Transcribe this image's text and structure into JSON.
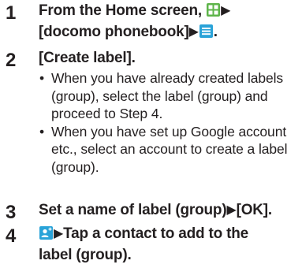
{
  "steps": [
    {
      "number": "1",
      "title_line1_prefix": "From the Home screen, ",
      "title_line2": "[docomo phonebook]",
      "title_line2_suffix": ".",
      "icons": [
        "apps-grid-icon",
        "menu-icon"
      ]
    },
    {
      "number": "2",
      "title": "[Create label].",
      "bullets": [
        "When you have already created labels (group), select the label (group) and proceed to Step 4.",
        "When you have set up Google account etc., select an account to create a label (group)."
      ]
    },
    {
      "number": "3",
      "title_part1": "Set a name of label (group)",
      "title_part2": "[OK]."
    },
    {
      "number": "4",
      "title_line1_suffix": "Tap a contact to add to the",
      "title_line2": "label (group).",
      "icons": [
        "add-contact-icon"
      ]
    }
  ],
  "arrow_glyph": "▶",
  "bullet_glyph": "•",
  "colors": {
    "text": "#231f20",
    "icon_green": "#5eb44a",
    "icon_blue": "#2aa3d8"
  }
}
